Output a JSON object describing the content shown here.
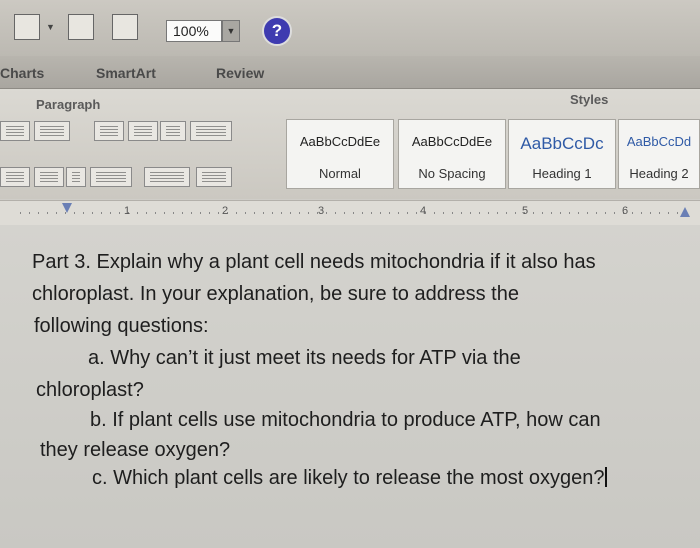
{
  "toolbar": {
    "zoom_value": "100%",
    "help_label": "?"
  },
  "tabs": [
    "Charts",
    "SmartArt",
    "Review"
  ],
  "ribbon": {
    "paragraph_label": "Paragraph",
    "styles_label": "Styles",
    "style_tiles": [
      {
        "sample": "AaBbCcDdEe",
        "name": "Normal"
      },
      {
        "sample": "AaBbCcDdEe",
        "name": "No Spacing"
      },
      {
        "sample": "AaBbCcDc",
        "name": "Heading 1"
      },
      {
        "sample": "AaBbCcDd",
        "name": "Heading 2"
      }
    ]
  },
  "ruler": {
    "numbers": [
      "1",
      "2",
      "3",
      "4",
      "5",
      "6"
    ]
  },
  "document": {
    "lines": [
      "Part 3.  Explain why a plant cell needs mitochondria if it also has",
      "chloroplast. In your explanation, be sure to address the",
      "following questions:",
      "a. Why can’t it just meet its needs for ATP via the",
      "chloroplast?",
      "b. If plant cells use mitochondria to produce ATP, how can",
      "they release oxygen?",
      "c. Which plant cells are likely to release the most oxygen?"
    ]
  }
}
